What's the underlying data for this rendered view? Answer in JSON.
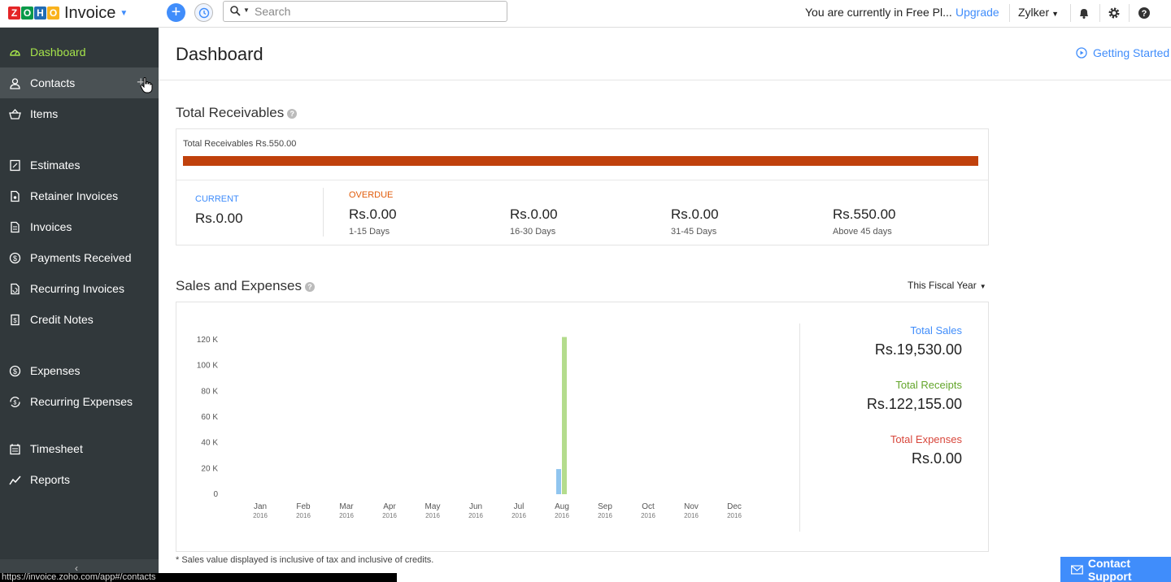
{
  "app": {
    "name": "Invoice",
    "logo_letters": [
      "Z",
      "O",
      "H",
      "O"
    ],
    "logo_colors": [
      "#e42527",
      "#089949",
      "#226db4",
      "#f9b21d"
    ]
  },
  "topbar": {
    "search_placeholder": "Search",
    "plan_text": "You are currently in Free Pl...",
    "upgrade_label": "Upgrade",
    "org_name": "Zylker",
    "icons": [
      "plus-icon",
      "history-icon",
      "search-icon",
      "bell-icon",
      "gear-icon",
      "help-icon"
    ]
  },
  "sidebar": {
    "items": [
      {
        "label": "Dashboard",
        "icon": "dashboard-icon",
        "active": true
      },
      {
        "label": "Contacts",
        "icon": "contacts-icon",
        "hover": true,
        "add": "+"
      },
      {
        "label": "Items",
        "icon": "items-icon"
      },
      {
        "label": "Estimates",
        "icon": "estimates-icon"
      },
      {
        "label": "Retainer Invoices",
        "icon": "retainer-icon"
      },
      {
        "label": "Invoices",
        "icon": "invoices-icon"
      },
      {
        "label": "Payments Received",
        "icon": "payments-icon"
      },
      {
        "label": "Recurring Invoices",
        "icon": "recurring-invoices-icon"
      },
      {
        "label": "Credit Notes",
        "icon": "credit-notes-icon"
      },
      {
        "label": "Expenses",
        "icon": "expenses-icon"
      },
      {
        "label": "Recurring Expenses",
        "icon": "recurring-expenses-icon"
      },
      {
        "label": "Timesheet",
        "icon": "timesheet-icon"
      },
      {
        "label": "Reports",
        "icon": "reports-icon"
      }
    ],
    "footer_glyph": "‹"
  },
  "status_url": "https://invoice.zoho.com/app#/contacts",
  "main": {
    "title": "Dashboard",
    "getting_started": "Getting Started",
    "receivables": {
      "title": "Total Receivables",
      "total_label": "Total Receivables Rs.550.00",
      "overdue_fraction": 1.0,
      "current": {
        "head": "CURRENT",
        "amount": "Rs.0.00"
      },
      "overdue_head": "OVERDUE",
      "buckets": [
        {
          "amount": "Rs.0.00",
          "range": "1-15 Days"
        },
        {
          "amount": "Rs.0.00",
          "range": "16-30 Days"
        },
        {
          "amount": "Rs.0.00",
          "range": "31-45 Days"
        },
        {
          "amount": "Rs.550.00",
          "range": "Above 45 days"
        }
      ],
      "colors": {
        "current": "#408dfb",
        "overdue": "#e15c0b",
        "bar": "#c0410c"
      }
    },
    "sales": {
      "title": "Sales and Expenses",
      "period": "This Fiscal Year",
      "totals": [
        {
          "label": "Total Sales",
          "value": "Rs.19,530.00",
          "color": "#408dfb"
        },
        {
          "label": "Total Receipts",
          "value": "Rs.122,155.00",
          "color": "#63a52a"
        },
        {
          "label": "Total Expenses",
          "value": "Rs.0.00",
          "color": "#d8473c"
        }
      ],
      "footnote": "* Sales value displayed is inclusive of tax and inclusive of credits."
    }
  },
  "support_label": "Contact Support",
  "chart_data": {
    "type": "bar",
    "categories": [
      "Jan",
      "Feb",
      "Mar",
      "Apr",
      "May",
      "Jun",
      "Jul",
      "Aug",
      "Sep",
      "Oct",
      "Nov",
      "Dec"
    ],
    "category_sublabel": "2016",
    "series": [
      {
        "name": "Sales",
        "color": "#90c5ef",
        "values": [
          0,
          0,
          0,
          0,
          0,
          0,
          0,
          19530,
          0,
          0,
          0,
          0
        ]
      },
      {
        "name": "Receipts",
        "color": "#b4dc8d",
        "values": [
          0,
          0,
          0,
          0,
          0,
          0,
          0,
          122155,
          0,
          0,
          0,
          0
        ]
      },
      {
        "name": "Expenses",
        "color": "#f0a39d",
        "values": [
          0,
          0,
          0,
          0,
          0,
          0,
          0,
          0,
          0,
          0,
          0,
          0
        ]
      }
    ],
    "yticks": [
      "0",
      "20 K",
      "40 K",
      "60 K",
      "80 K",
      "100 K",
      "120 K"
    ],
    "ylim": [
      0,
      120000
    ],
    "grid": false
  }
}
